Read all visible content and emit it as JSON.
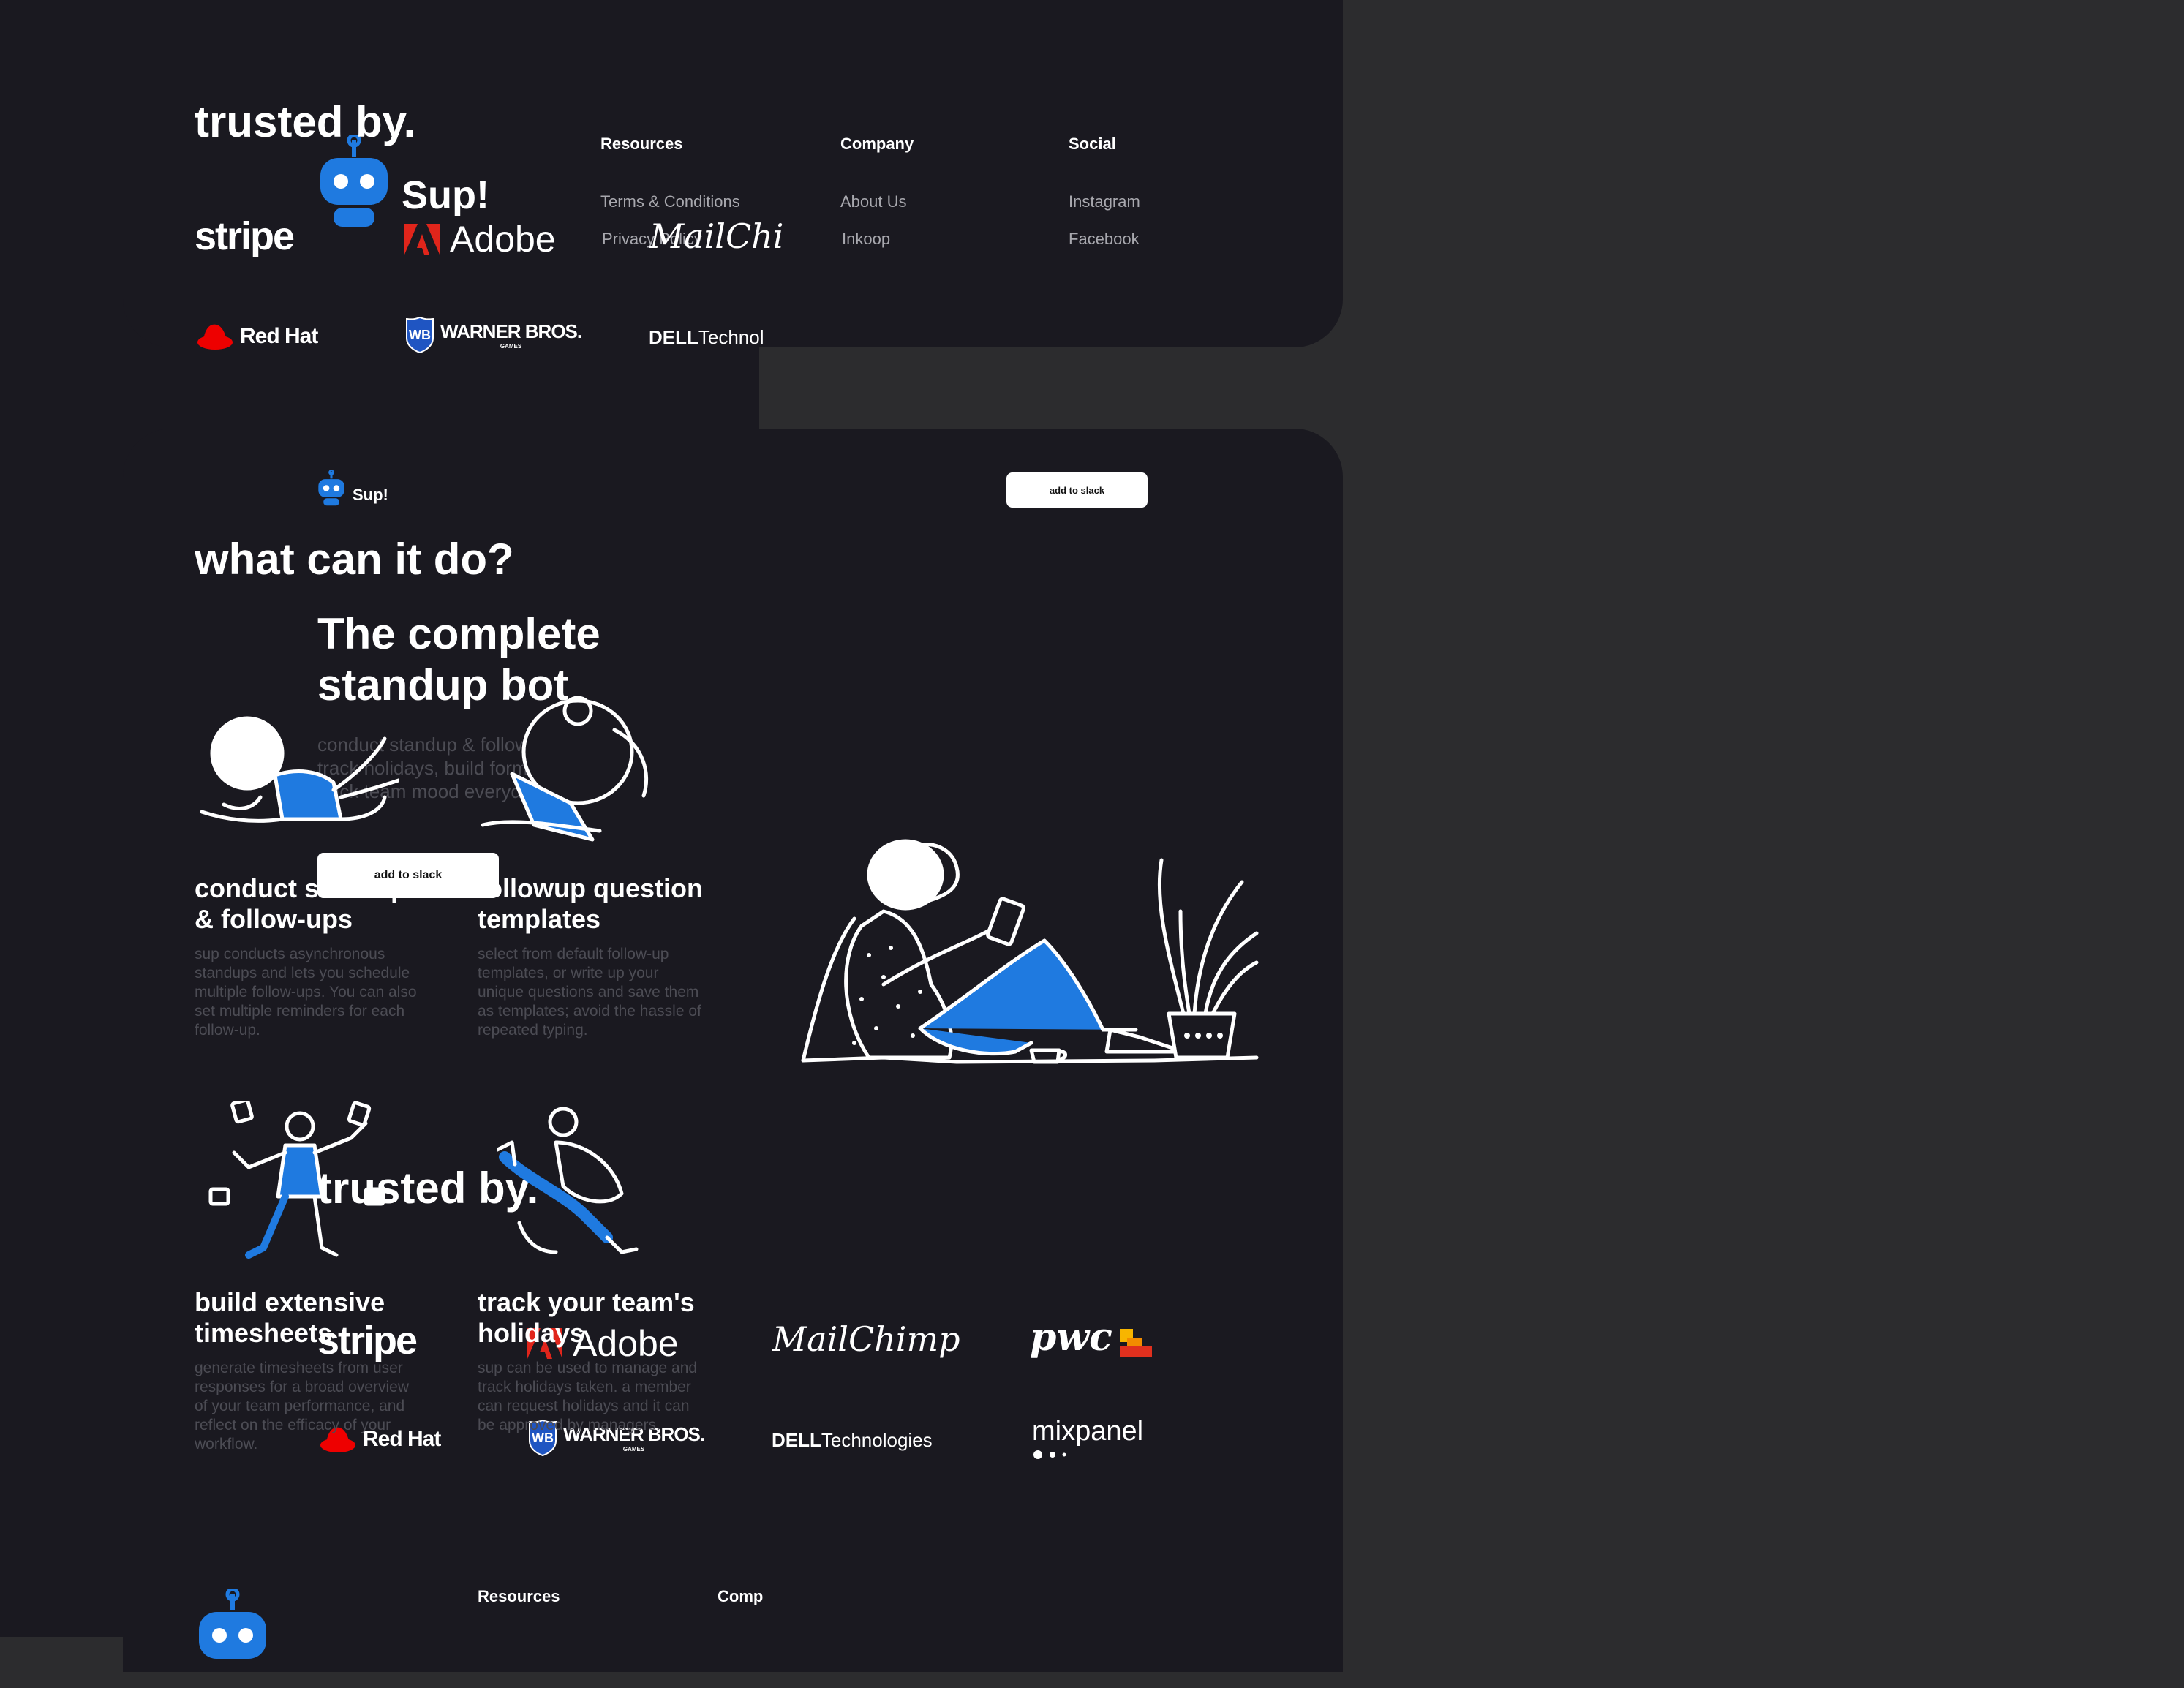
{
  "colors": {
    "accent_blue": "#1f7ae0",
    "card_bg": "#1a1920",
    "page_bg": "#2c2c2e",
    "muted_text": "#4c4c54",
    "adobe_red": "#e0251b",
    "redhat_red": "#e00",
    "wb_blue": "#1f55c2",
    "pwc_orange": "#f28b00"
  },
  "footer": {
    "logo_text": "Sup!",
    "columns": [
      {
        "heading": "Resources",
        "links": [
          "Terms & Conditions",
          "Privacy Policy"
        ]
      },
      {
        "heading": "Company",
        "links": [
          "About Us",
          "Inkoop"
        ]
      },
      {
        "heading": "Social",
        "links": [
          "Instagram",
          "Facebook"
        ]
      }
    ]
  },
  "landing": {
    "logo_text": "Sup!",
    "nav_button": "add to slack",
    "hero_title_line1": "The complete",
    "hero_title_line2": "standup bot",
    "hero_subtitle_lines": [
      "conduct standup & follow-ups,",
      "track holidays, build forms &",
      "track team mood everyday"
    ],
    "hero_button": "add to slack",
    "trusted_title": "trusted by.",
    "logos_row1": [
      "stripe",
      "Adobe",
      "MailChimp",
      "pwc"
    ],
    "logos_row2": [
      "Red Hat",
      "WARNER BROS.",
      "DELL Technologies",
      "mixpanel"
    ],
    "wb_sub": "GAMES",
    "dell_brand": "DELL",
    "dell_suffix": "Technologies"
  },
  "right_panel": {
    "trusted_title": "trusted by.",
    "logos_row1": [
      "stripe",
      "Adobe",
      "MailChi"
    ],
    "logos_row2": [
      "Red Hat",
      "WARNER BROS.",
      "DELL Technol"
    ],
    "wb_sub": "GAMES",
    "dell_brand": "DELL",
    "dell_suffix": "Technol",
    "section_title": "what can it do?",
    "features": [
      {
        "title_lines": [
          "conduct standup",
          "& follow-ups"
        ],
        "desc_lines": [
          "sup conducts asynchronous",
          "standups and lets you schedule",
          "multiple follow-ups. You can also",
          "set multiple reminders for each",
          "follow-up."
        ]
      },
      {
        "title_lines": [
          "followup question",
          "templates"
        ],
        "desc_lines": [
          "select from default follow-up",
          "templates, or write up your",
          "unique questions and save them",
          "as templates; avoid the hassle of",
          "repeated typing."
        ]
      },
      {
        "title_lines": [
          "build extensive",
          "timesheets"
        ],
        "desc_lines": [
          "generate timesheets from user",
          "responses for a broad overview",
          "of your team performance, and",
          "reflect on the efficacy of your",
          "workflow."
        ]
      },
      {
        "title_lines": [
          "track your team's",
          "holidays"
        ],
        "desc_lines": [
          "sup can be used to manage and",
          "track holidays taken. a member",
          "can request holidays and it can",
          "be approved by managers."
        ]
      }
    ],
    "footer_peek": {
      "resources": "Resources",
      "company_fragment": "Comp"
    }
  }
}
